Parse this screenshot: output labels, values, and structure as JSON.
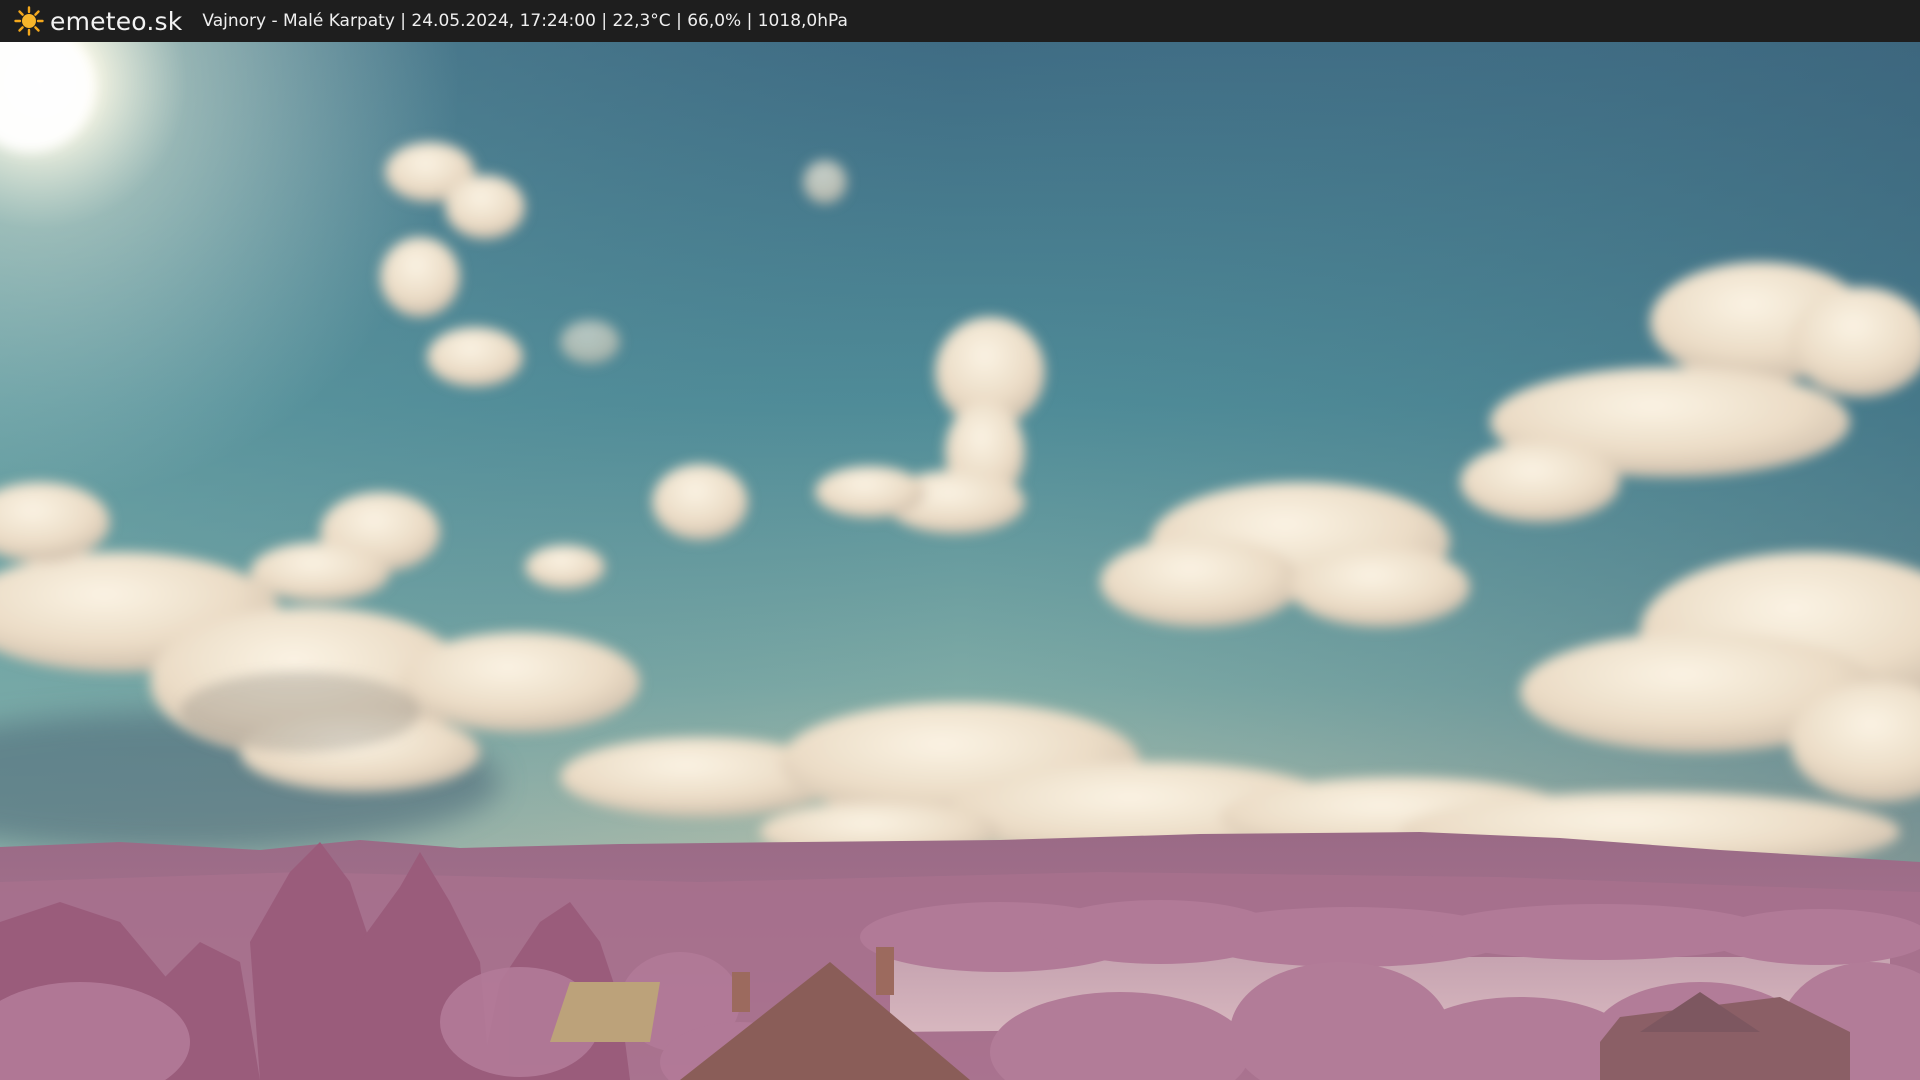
{
  "header": {
    "logo_text": "emeteo.sk",
    "caption": "Vajnory - Malé Karpaty | 24.05.2024, 17:24:00 | 22,3°C | 66,0% | 1018,0hPa"
  },
  "icons": {
    "logo": "sun-icon"
  },
  "colors": {
    "bar_background": "#1e1e1e",
    "sky_top": "#3e6a82",
    "sky_horizon": "#c9c7a6",
    "foliage": "#a86a8a",
    "sun": "#fff6dc"
  }
}
